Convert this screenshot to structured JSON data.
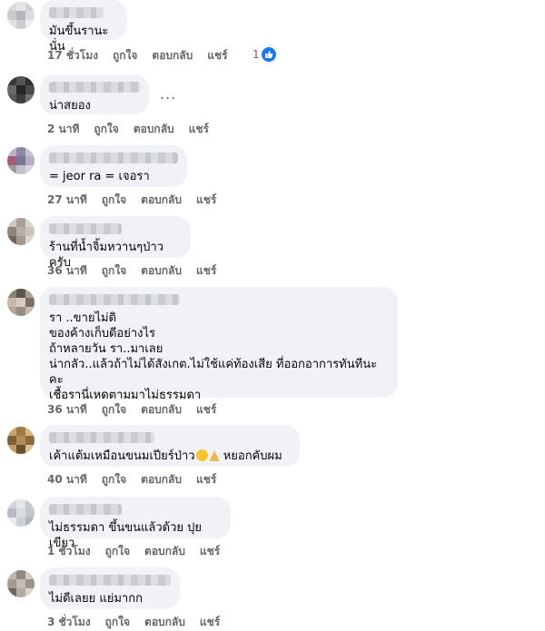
{
  "comments": [
    {
      "text": "มันขึ้นรานะนั่น",
      "time": "17 ชั่วโมง",
      "like": "ถูกใจ",
      "reply": "ตอบกลับ",
      "share": "แชร์",
      "reaction_count": "1"
    },
    {
      "text": "น่าสยอง",
      "time": "2 นาที",
      "like": "ถูกใจ",
      "reply": "ตอบกลับ",
      "share": "แชร์",
      "more": "..."
    },
    {
      "text": "= jeor ra = เจอรา",
      "time": "27 นาที",
      "like": "ถูกใจ",
      "reply": "ตอบกลับ",
      "share": "แชร์"
    },
    {
      "text": "ร้านที่น้ำจิ้มหวานๆป่าวครับ",
      "time": "36 นาที",
      "like": "ถูกใจ",
      "reply": "ตอบกลับ",
      "share": "แชร์"
    },
    {
      "text": "รา ..ขายไม่ดิ\nของค้างเก็บดีอย่างไร\nถ้าหลายวัน รา..มาเลย\nน่ากลัว..แล้วถ้าไม่ได้สังเกต.ไม่ใช้แค่ท้องเสีย ที่ออกอาการทันทีนะคะ\nเชื้อรานี่เหดตามมาไม่ธรรมดา",
      "time": "36 นาที",
      "like": "ถูกใจ",
      "reply": "ตอบกลับ",
      "share": "แชร์"
    },
    {
      "text_before": "เค้าแต้มเหมือนขนมเปียร์ป่าว",
      "text_after": " หยอกคับผม",
      "time": "40 นาที",
      "like": "ถูกใจ",
      "reply": "ตอบกลับ",
      "share": "แชร์"
    },
    {
      "text": "ไม่ธรรมดา ขึ้นขนแล้วด้วย ปุยเขียว",
      "time": "1 ชั่วโมง",
      "like": "ถูกใจ",
      "reply": "ตอบกลับ",
      "share": "แชร์"
    },
    {
      "text": "ไม่ดีเลยย แย่มากก",
      "time": "3 ชั่วโมง",
      "like": "ถูกใจ",
      "reply": "ตอบกลับ",
      "share": "แชร์"
    }
  ],
  "colors": {
    "bubble": "#f0f2f5",
    "meta": "#65676b",
    "like_blue": "#1877f2"
  }
}
